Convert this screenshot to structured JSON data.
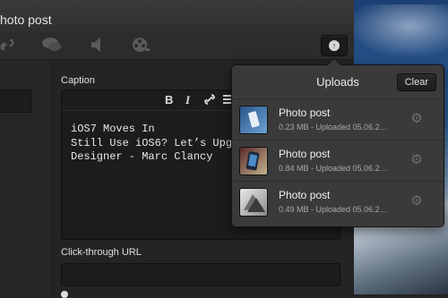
{
  "window": {
    "title": "hoto post"
  },
  "toolbar": {
    "icons": [
      "link-icon",
      "chat-icon",
      "audio-icon",
      "video-icon"
    ],
    "upload_icon": "upload-icon"
  },
  "form": {
    "caption_label": "Caption",
    "caption_text": "iOS7 Moves In\nStill Use iOS6? Let’s Upg\nDesigner - Marc Clancy",
    "format_buttons": [
      "B",
      "I"
    ],
    "clickthrough_label": "Click-through URL",
    "clickthrough_value": ""
  },
  "uploads": {
    "title": "Uploads",
    "clear_label": "Clear",
    "items": [
      {
        "title": "Photo post",
        "meta": "0.23 MB - Uploaded 05.06.2…",
        "thumb_color": "#3f6fa6"
      },
      {
        "title": "Photo post",
        "meta": "0.84 MB - Uploaded 05.06.2…",
        "thumb_color": "#7a3b3b"
      },
      {
        "title": "Photo post",
        "meta": "0.49 MB - Uploaded 05.06.2…",
        "thumb_color": "#c9c9c9"
      }
    ]
  }
}
